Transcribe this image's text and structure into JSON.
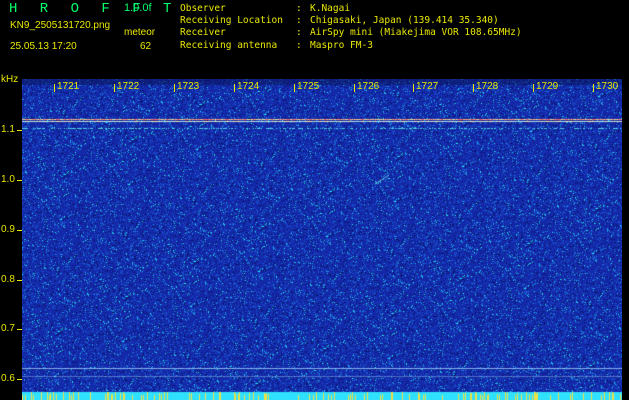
{
  "header": {
    "brand": "H R O F F T",
    "version": "1.0.0f",
    "filename": "KN9_2505131720.png",
    "datetime": "25.05.13 17:20",
    "mode_label": "meteor",
    "mode_value": "62"
  },
  "station": [
    {
      "label": "Observer",
      "value": "K.Nagai"
    },
    {
      "label": "Receiving Location",
      "value": "Chigasaki, Japan (139.414 35.340)"
    },
    {
      "label": "Receiver",
      "value": "AirSpy mini (Miakejima VOR 108.65MHz)"
    },
    {
      "label": "Receiving antenna",
      "value": "Maspro FM-3"
    }
  ],
  "axes": {
    "y_unit": "kHz",
    "y_ticks": [
      "1.1",
      "1.0",
      "0.9",
      "0.8",
      "0.7",
      "0.6"
    ],
    "x_ticks": [
      "1721",
      "1722",
      "1723",
      "1724",
      "1725",
      "1726",
      "1727",
      "1728",
      "1729",
      "1730"
    ]
  },
  "colors": {
    "background": "#000000",
    "text": "#e8e800",
    "brand": "#00ff6a",
    "spectrum_base": "#1a2ab0"
  }
}
